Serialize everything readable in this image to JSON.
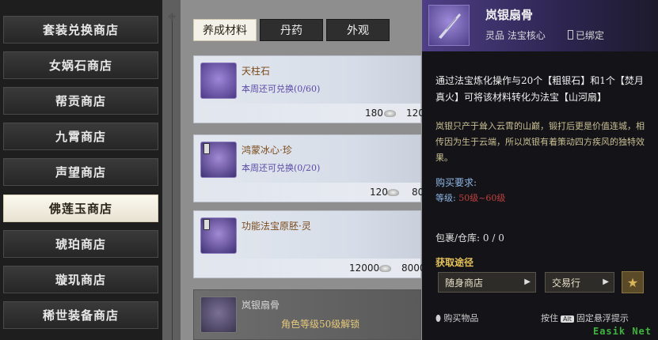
{
  "sidebar": {
    "items": [
      {
        "label": "套装兑换商店",
        "active": false
      },
      {
        "label": "女娲石商店",
        "active": false
      },
      {
        "label": "帮贡商店",
        "active": false
      },
      {
        "label": "九霄商店",
        "active": false
      },
      {
        "label": "声望商店",
        "active": false
      },
      {
        "label": "佛莲玉商店",
        "active": true
      },
      {
        "label": "琥珀商店",
        "active": false
      },
      {
        "label": "璇玑商店",
        "active": false
      },
      {
        "label": "稀世装备商店",
        "active": false
      }
    ]
  },
  "tabs": [
    {
      "label": "养成材料",
      "active": true
    },
    {
      "label": "丹药",
      "active": false
    },
    {
      "label": "外观",
      "active": false
    }
  ],
  "items": [
    {
      "name": "天柱石",
      "quota": "本周还可兑换(0/60)",
      "price_left": "180",
      "price_right": "120"
    },
    {
      "name": "鸿蒙冰心·珍",
      "quota": "本周还可兑换(0/20)",
      "price_left": "120",
      "price_right": "80"
    },
    {
      "name": "功能法宝原胚·灵",
      "quota": "",
      "price_left": "12000",
      "price_right": "8000"
    },
    {
      "name": "岚银扇骨",
      "lock": "角色等级50级解锁"
    }
  ],
  "tooltip": {
    "title": "岚银扇骨",
    "grade": "灵品  法宝核心",
    "bind": "已绑定",
    "desc": "通过法宝炼化操作与20个【粗银石】和1个【焚月真火】可将该材料转化为法宝【山河扇】",
    "lore": "岚银只产于耸入云霄的山巅，锻打后更是价值连城，相传因为生于云端，所以岚银有着策动四方疾风的独特效果。",
    "req_title": "购买要求:",
    "req_label": "等级:",
    "req_value": "50级~60级",
    "bag": "包裹/仓库:  0 / 0",
    "source_title": "获取途径",
    "source_1": "随身商店",
    "source_2": "交易行",
    "footer_left": "购买物品",
    "footer_press": "按住",
    "footer_key": "Alt",
    "footer_hint": "固定悬浮提示"
  },
  "watermark": "Easik Net"
}
